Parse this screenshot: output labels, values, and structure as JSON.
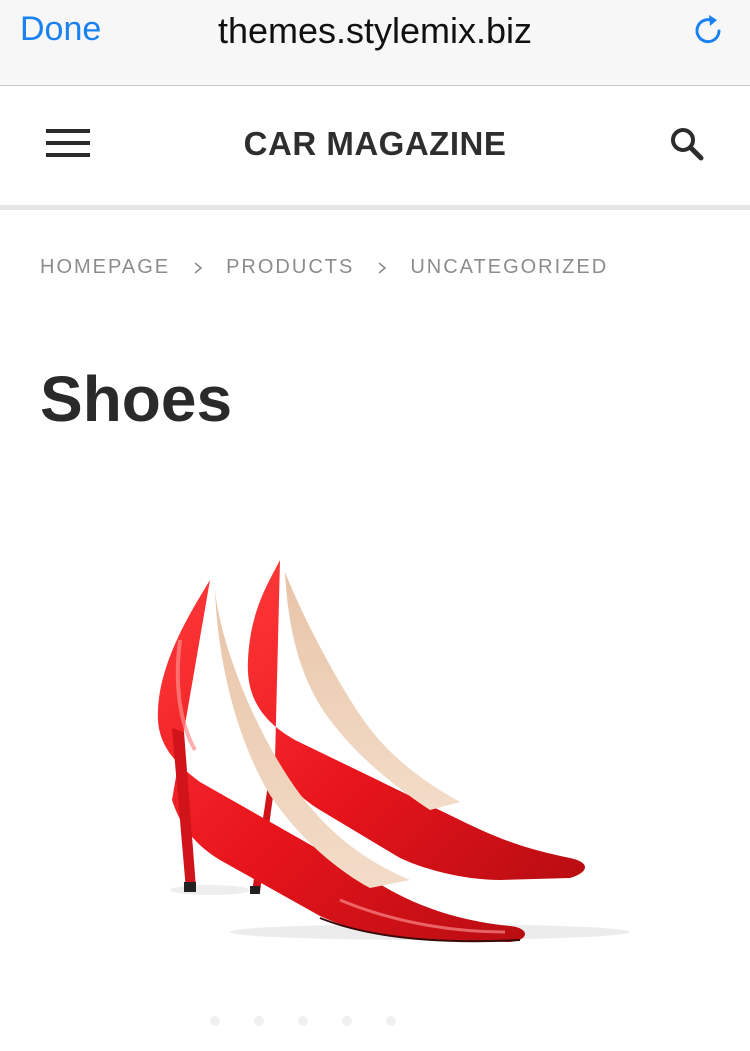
{
  "browser": {
    "done_label": "Done",
    "url": "themes.stylemix.biz",
    "accent_color": "#1a82f0"
  },
  "header": {
    "title": "CAR MAGAZINE",
    "menu_icon": "hamburger-icon",
    "search_icon": "search-icon"
  },
  "breadcrumb": {
    "items": [
      "HOMEPAGE",
      "PRODUCTS",
      "UNCATEGORIZED"
    ],
    "separator_icon": "chevron-right-icon"
  },
  "product": {
    "title": "Shoes",
    "image": "red-high-heel-shoes",
    "shoe_color": "#e8141c"
  }
}
